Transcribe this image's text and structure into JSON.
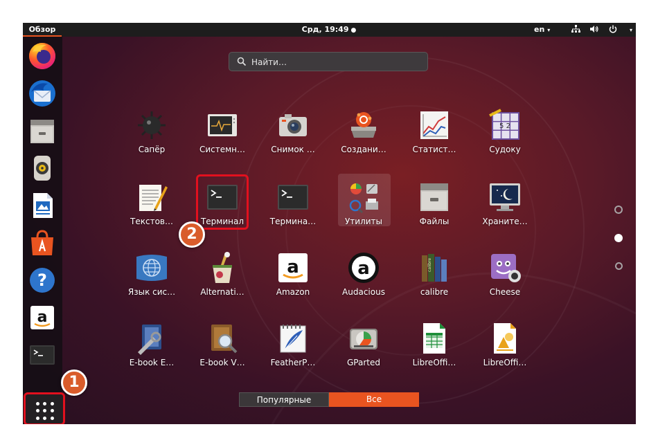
{
  "topbar": {
    "activities": "Обзор",
    "clock": "Срд, 19:49",
    "clock_dot": "●",
    "language": "en",
    "caret": "▾"
  },
  "dock": {
    "items": [
      {
        "name": "firefox-icon"
      },
      {
        "name": "thunderbird-icon"
      },
      {
        "name": "files-icon"
      },
      {
        "name": "rhythmbox-icon"
      },
      {
        "name": "writer-icon"
      },
      {
        "name": "software-icon"
      },
      {
        "name": "help-icon"
      },
      {
        "name": "amazon-icon"
      },
      {
        "name": "terminal-icon"
      }
    ],
    "show_apps_badge": "1"
  },
  "search": {
    "placeholder": "Найти…"
  },
  "apps": [
    {
      "label": "Сапёр",
      "icon": "mines-icon"
    },
    {
      "label": "Системн…",
      "icon": "system-monitor-icon"
    },
    {
      "label": "Снимок …",
      "icon": "camera-icon"
    },
    {
      "label": "Создани…",
      "icon": "startup-disk-icon"
    },
    {
      "label": "Статист…",
      "icon": "statistics-icon"
    },
    {
      "label": "Судоку",
      "icon": "sudoku-icon"
    },
    {
      "label": "Текстов…",
      "icon": "text-editor-icon"
    },
    {
      "label": "Терминал",
      "icon": "terminal-icon"
    },
    {
      "label": "Термина…",
      "icon": "terminal-icon"
    },
    {
      "label": "Утилиты",
      "icon": "utilities-folder-icon"
    },
    {
      "label": "Файлы",
      "icon": "files-icon"
    },
    {
      "label": "Хранитe…",
      "icon": "screensaver-icon"
    },
    {
      "label": "Язык сис…",
      "icon": "language-icon"
    },
    {
      "label": "Alternati…",
      "icon": "alternatives-icon"
    },
    {
      "label": "Amazon",
      "icon": "amazon-icon"
    },
    {
      "label": "Audacious",
      "icon": "audacious-icon"
    },
    {
      "label": "calibre",
      "icon": "calibre-icon"
    },
    {
      "label": "Cheese",
      "icon": "cheese-icon"
    },
    {
      "label": "E-book E…",
      "icon": "ebook-editor-icon"
    },
    {
      "label": "E-book V…",
      "icon": "ebook-viewer-icon"
    },
    {
      "label": "FeatherP…",
      "icon": "featherpad-icon"
    },
    {
      "label": "GParted",
      "icon": "gparted-icon"
    },
    {
      "label": "LibreOffi…",
      "icon": "calc-icon"
    },
    {
      "label": "LibreOffi…",
      "icon": "draw-icon"
    }
  ],
  "terminal_badge": "2",
  "tabs": {
    "popular": "Популярные",
    "all": "Все"
  },
  "colors": {
    "accent": "#e95420",
    "highlight": "#e2101e",
    "badge": "#d95c2b"
  }
}
